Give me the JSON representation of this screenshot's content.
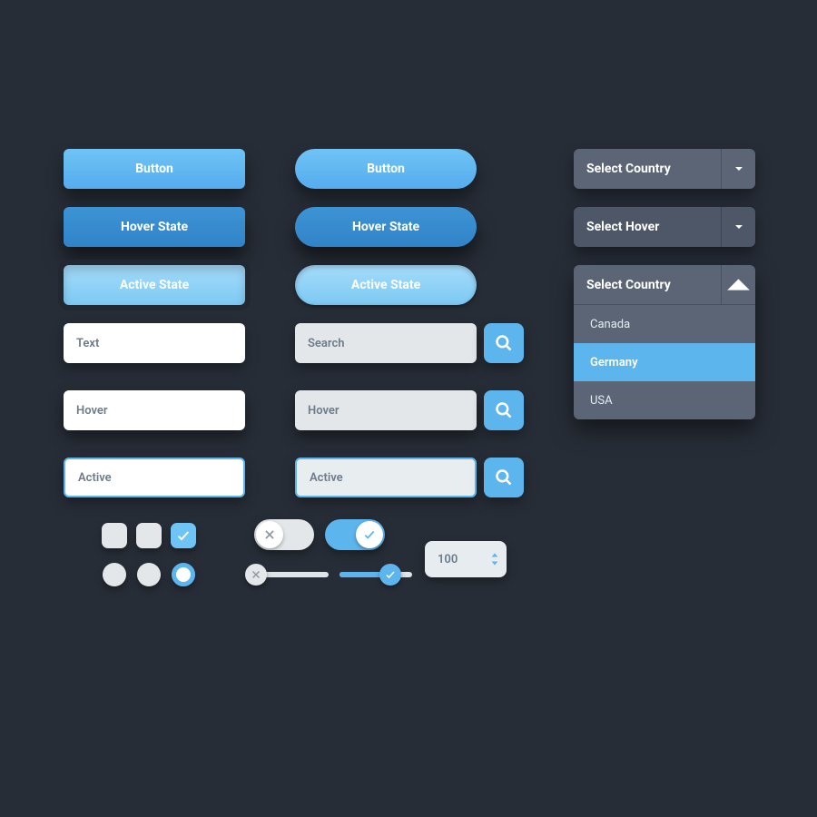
{
  "colors": {
    "accent": "#5db5ee",
    "bg": "#272d37",
    "panel": "#5b6575"
  },
  "buttons": {
    "rect_default": "Button",
    "rect_hover": "Hover State",
    "rect_active": "Active State",
    "pill_default": "Button",
    "pill_hover": "Hover State",
    "pill_active": "Active State"
  },
  "inputs": {
    "col1": {
      "default": "Text",
      "hover": "Hover",
      "active": "Active"
    },
    "col2": {
      "default": "Search",
      "hover": "Hover",
      "active": "Active"
    }
  },
  "selects": {
    "default": "Select Country",
    "hover": "Select Hover",
    "open": {
      "label": "Select Country",
      "options": [
        "Canada",
        "Germany",
        "USA"
      ],
      "selected": "Germany"
    }
  },
  "checkbox": {
    "states": [
      "off",
      "off",
      "on"
    ]
  },
  "radio": {
    "states": [
      "off",
      "off",
      "on"
    ]
  },
  "toggle": {
    "states": [
      "off",
      "on"
    ]
  },
  "slider": {
    "left_pct": 0,
    "right_pct": 70
  },
  "stepper": {
    "value": "100"
  }
}
